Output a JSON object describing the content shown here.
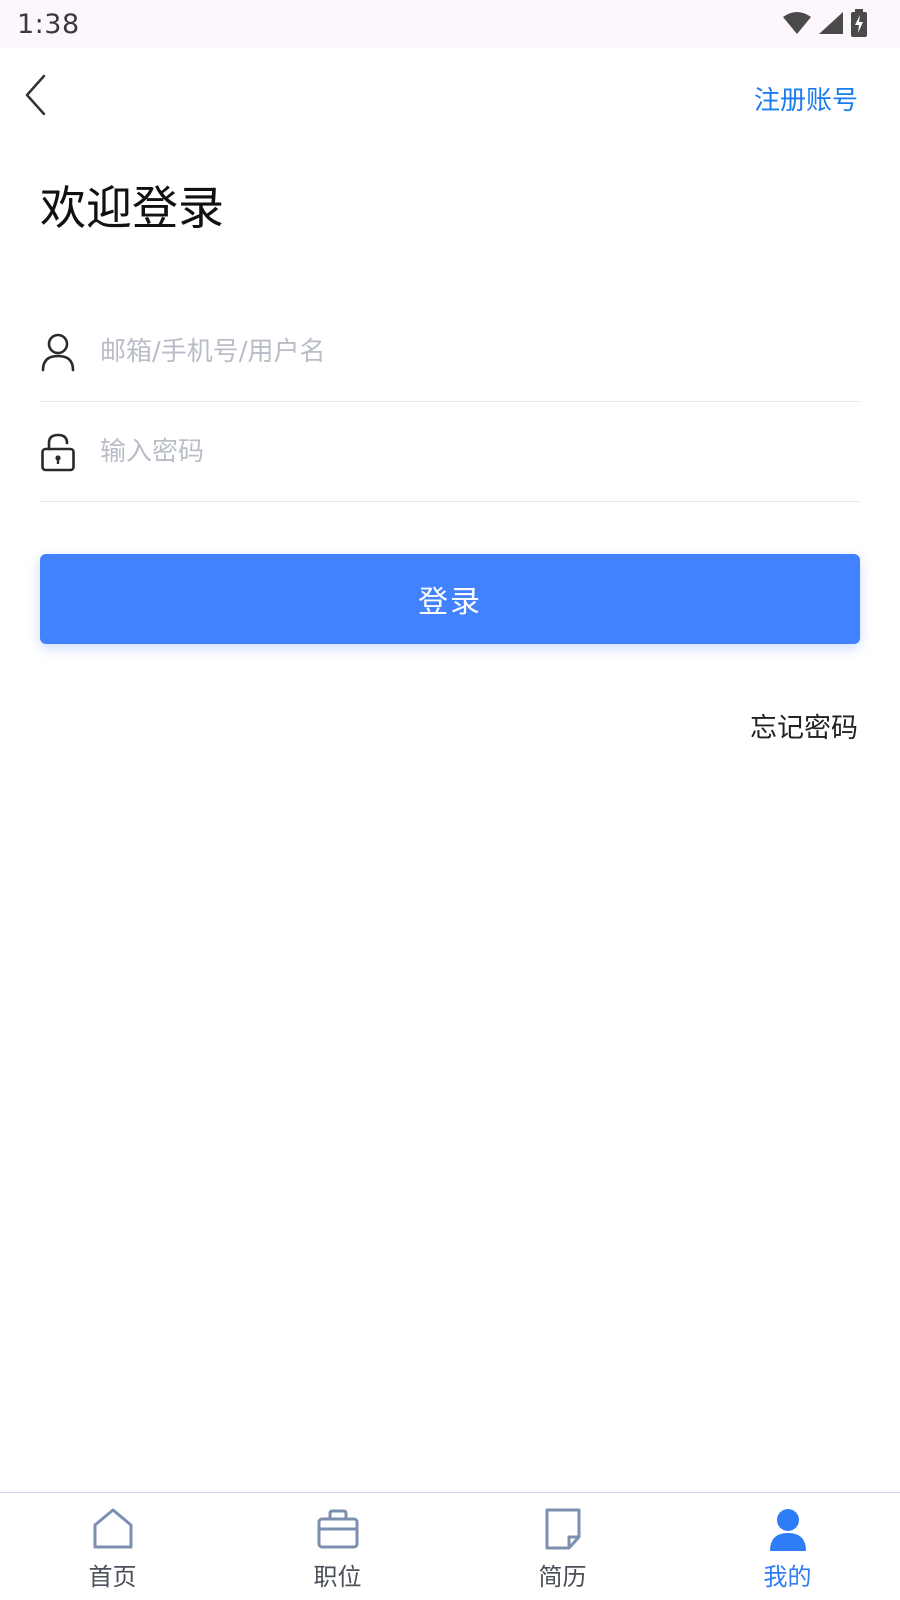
{
  "status_bar": {
    "time": "1:38",
    "icons": [
      "wifi-icon",
      "signal-icon",
      "battery-charging-icon"
    ]
  },
  "header": {
    "back_icon": "chevron-left-icon",
    "register_label": "注册账号"
  },
  "title": "欢迎登录",
  "form": {
    "username": {
      "icon": "user-icon",
      "placeholder": "邮箱/手机号/用户名",
      "value": ""
    },
    "password": {
      "icon": "lock-icon",
      "placeholder": "输入密码",
      "value": ""
    },
    "login_label": "登录",
    "forgot_label": "忘记密码"
  },
  "tabs": [
    {
      "label": "首页",
      "icon": "home-icon",
      "active": false
    },
    {
      "label": "职位",
      "icon": "briefcase-icon",
      "active": false
    },
    {
      "label": "简历",
      "icon": "document-icon",
      "active": false
    },
    {
      "label": "我的",
      "icon": "profile-icon",
      "active": true
    }
  ],
  "colors": {
    "accent": "#4281ff",
    "link": "#1b7cf0",
    "tab_inactive": "#7d8fb1",
    "tab_active": "#2e7cf6"
  }
}
